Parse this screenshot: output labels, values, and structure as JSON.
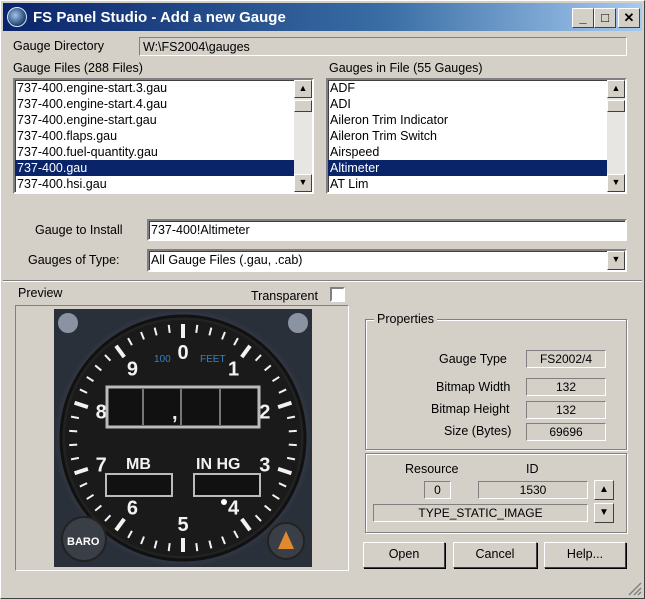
{
  "window": {
    "title": "FS Panel Studio - Add a new Gauge"
  },
  "title_buttons": {
    "minimize": "_",
    "maximize": "□",
    "close": "✕"
  },
  "gauge_directory": {
    "label": "Gauge Directory",
    "value": "W:\\FS2004\\gauges"
  },
  "gauge_files": {
    "label": "Gauge Files",
    "count": "(288 Files)",
    "items": [
      "737-400.engine-start.3.gau",
      "737-400.engine-start.4.gau",
      "737-400.engine-start.gau",
      "737-400.flaps.gau",
      "737-400.fuel-quantity.gau",
      "737-400.gau",
      "737-400.hsi.gau"
    ],
    "selected_index": 5
  },
  "gauges_in_file": {
    "label": "Gauges in File",
    "count": "(55 Gauges)",
    "items": [
      "ADF",
      "ADI",
      "Aileron Trim Indicator",
      "Aileron Trim Switch",
      "Airspeed",
      "Altimeter",
      "AT Lim"
    ],
    "selected_index": 5
  },
  "gauge_to_install": {
    "label": "Gauge to Install",
    "value": "737-400!Altimeter"
  },
  "gauges_of_type": {
    "label": "Gauges of Type:",
    "value": "All Gauge Files (.gau, .cab)"
  },
  "preview": {
    "label": "Preview",
    "transparent_label": "Transparent",
    "transparent_checked": false,
    "dial": {
      "numbers": [
        "0",
        "1",
        "2",
        "3",
        "4",
        "5",
        "6",
        "7",
        "8",
        "9"
      ],
      "text_100": "100",
      "text_feet": "FEET",
      "text_mb": "MB",
      "text_inhg": "IN HG",
      "text_baro": "BARO",
      "drum_mark": ","
    }
  },
  "properties": {
    "title": "Properties",
    "gauge_type_label": "Gauge Type",
    "gauge_type_value": "FS2002/4",
    "bitmap_width_label": "Bitmap Width",
    "bitmap_width_value": "132",
    "bitmap_height_label": "Bitmap Height",
    "bitmap_height_value": "132",
    "size_label": "Size (Bytes)",
    "size_value": "69696"
  },
  "resource": {
    "resource_label": "Resource",
    "id_label": "ID",
    "resource_value": "0",
    "id_value": "1530",
    "type_value": "TYPE_STATIC_IMAGE"
  },
  "buttons": {
    "open": "Open",
    "cancel": "Cancel",
    "help": "Help..."
  },
  "colors": {
    "title_start": "#0a246a",
    "title_end": "#a6caf0",
    "selection": "#0a246a",
    "face": "#d4d0c8"
  }
}
